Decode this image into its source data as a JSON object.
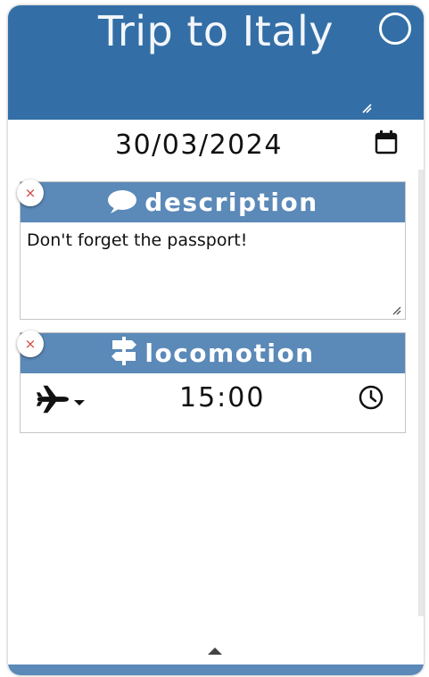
{
  "header": {
    "title": "Trip to Italy",
    "background_color": "#336fa6"
  },
  "date": {
    "value": "30/03/2024"
  },
  "sections": {
    "description": {
      "title": "description",
      "icon": "speech-bubble-icon",
      "text": "Don't forget the passport!",
      "remove_label": "×"
    },
    "locomotion": {
      "title": "locomotion",
      "icon": "signpost-icon",
      "transport_icon": "airplane-icon",
      "time": "15:00",
      "remove_label": "×"
    }
  },
  "colors": {
    "section_header": "#5b89b8",
    "remove_x": "#d04646"
  }
}
